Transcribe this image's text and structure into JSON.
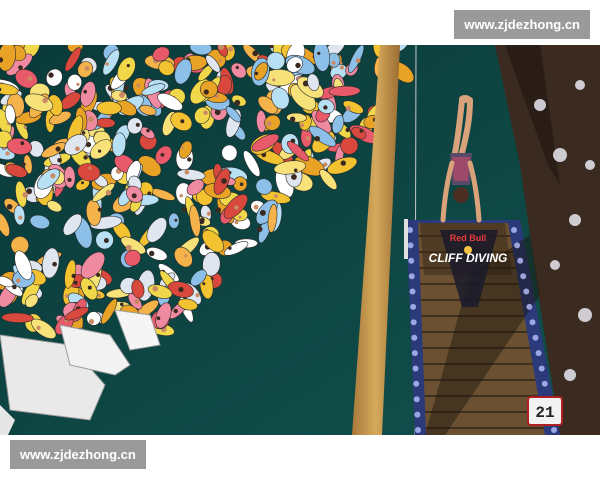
{
  "watermark_top": "www.zjdezhong.cn",
  "watermark_bottom": "www.zjdezhong.cn",
  "platform": {
    "brand": "Red Bull",
    "event": "CLIFF DIVING"
  },
  "counter_value": "21",
  "colors": {
    "water": "#0e3f3e",
    "pole": "#c89a4c",
    "platform_wood": "#6b5132",
    "platform_edge": "#2a3a7a",
    "cliff": "#3a2a20"
  }
}
